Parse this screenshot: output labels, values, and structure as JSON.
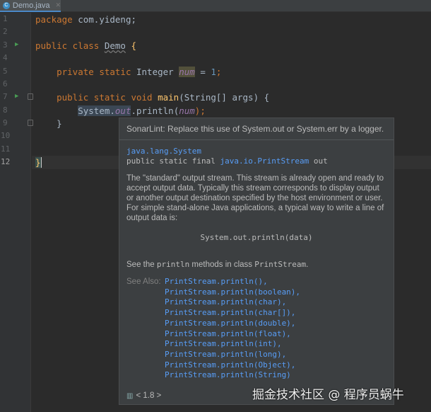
{
  "tab": {
    "filename": "Demo.java",
    "icon": "java-class-icon"
  },
  "line_numbers": [
    "1",
    "2",
    "3",
    "4",
    "5",
    "6",
    "7",
    "8",
    "9",
    "10",
    "11",
    "12"
  ],
  "code": {
    "l1": [
      "package",
      " com.yideng;"
    ],
    "l3": [
      "public class ",
      "Demo",
      " {"
    ],
    "l5": [
      "private static ",
      "Integer ",
      "num",
      " = ",
      "1",
      ";"
    ],
    "l7": [
      "public static void ",
      "main",
      "(String[] args) {"
    ],
    "l8": [
      "System.",
      "out",
      ".println(",
      "num",
      ");"
    ],
    "l9": "}",
    "l12": "}"
  },
  "popup": {
    "sonarlint": "SonarLint: Replace this use of System.out or System.err by a logger.",
    "class_link": "java.lang.System",
    "decl_prefix": "public static final ",
    "decl_type": "java.io.PrintStream",
    "decl_suffix": " out",
    "para1": "The \"standard\" output stream. This stream is already open and ready to accept output data. Typically this stream corresponds to display output or another output destination specified by the host environment or user.",
    "para2": "For simple stand-alone Java applications, a typical way to write a line of output data is:",
    "sample": "System.out.println(data)",
    "see_pre": "See the ",
    "see_code1": "println",
    "see_mid": " methods in class ",
    "see_code2": "PrintStream",
    "see_post": ".",
    "see_also_label": "See Also:",
    "see_also": [
      "PrintStream.println(),",
      "PrintStream.println(boolean),",
      "PrintStream.println(char),",
      "PrintStream.println(char[]),",
      "PrintStream.println(double),",
      "PrintStream.println(float),",
      "PrintStream.println(int),",
      "PrintStream.println(long),",
      "PrintStream.println(Object),",
      "PrintStream.println(String)"
    ],
    "footer": "< 1.8 >"
  },
  "watermark": "掘金技术社区 @ 程序员蜗牛"
}
